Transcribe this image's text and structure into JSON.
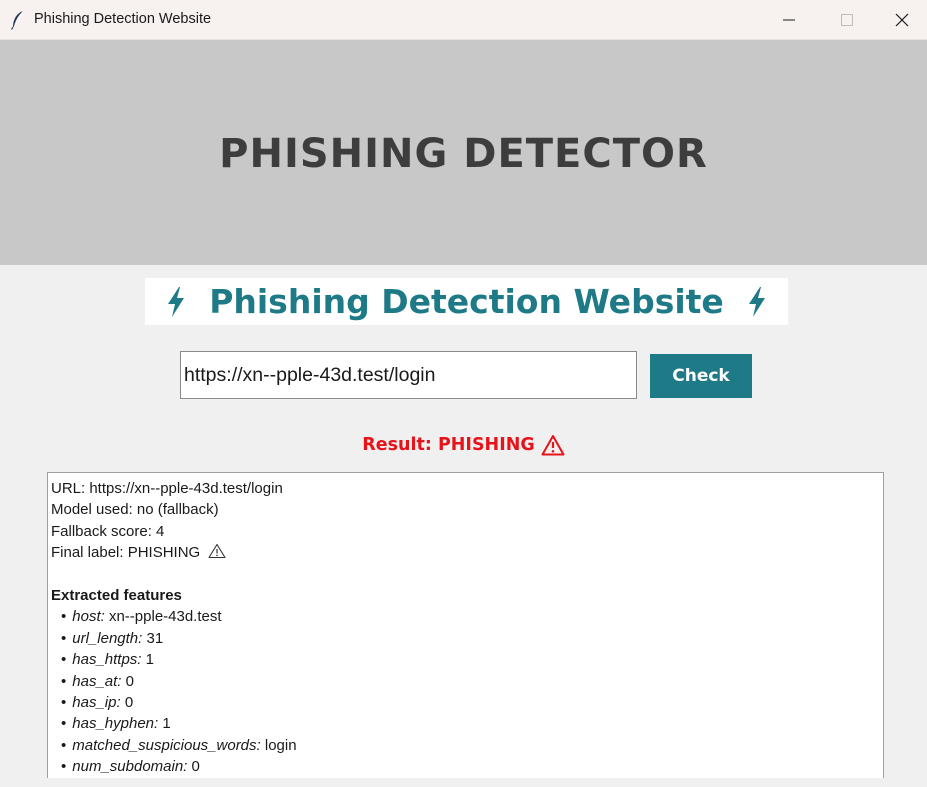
{
  "window": {
    "title": "Phishing Detection Website",
    "icon": "feather-icon"
  },
  "banner": {
    "title": "PHISHING DETECTOR",
    "background": "#c8c8c8",
    "text_color": "#3d3d3d"
  },
  "subtitle": {
    "text": "Phishing Detection Website",
    "icon": "lightning-bolt-icon",
    "color": "#1e7a87"
  },
  "url_input": {
    "value": "https://xn--pple-43d.test/login"
  },
  "check_button": {
    "label": "Check",
    "color": "#1e7a87"
  },
  "result": {
    "text": "Result: PHISHING",
    "icon": "warning-icon",
    "color": "#e6131a"
  },
  "details": {
    "url_line": "URL: https://xn--pple-43d.test/login",
    "model_line": "Model used: no (fallback)",
    "score_line": "Fallback score: 4",
    "label_line": "Final label: PHISHING",
    "features_heading": "Extracted features",
    "features": [
      {
        "key": "host:",
        "value": "xn--pple-43d.test"
      },
      {
        "key": "url_length:",
        "value": "31"
      },
      {
        "key": "has_https:",
        "value": "1"
      },
      {
        "key": "has_at:",
        "value": "0"
      },
      {
        "key": "has_ip:",
        "value": "0"
      },
      {
        "key": "has_hyphen:",
        "value": "1"
      },
      {
        "key": "matched_suspicious_words:",
        "value": "login"
      },
      {
        "key": "num_subdomain:",
        "value": "0"
      }
    ],
    "bullet": "•"
  }
}
